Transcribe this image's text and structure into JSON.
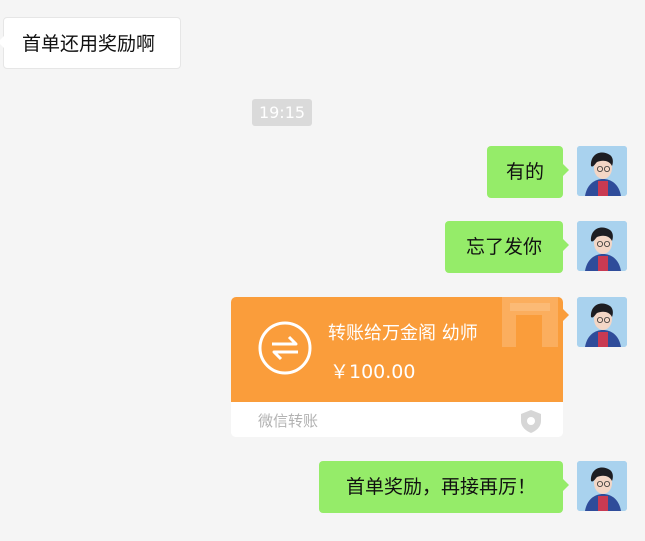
{
  "messages": {
    "incoming_1": "首单还用奖励啊",
    "timestamp": "19:15",
    "outgoing_1": "有的",
    "outgoing_2": "忘了发你",
    "transfer": {
      "recipient": "转账给万金阁 幼师",
      "amount": "￥100.00",
      "label": "微信转账"
    },
    "outgoing_3": "首单奖励，再接再厉！"
  },
  "colors": {
    "background": "#f5f5f5",
    "outgoing_bubble": "#95ec69",
    "transfer_orange": "#fa9d3b",
    "timestamp_bg": "#dadada"
  },
  "icons": [
    "transfer-arrows-icon",
    "wechat-pay-shield-icon",
    "user-avatar"
  ]
}
